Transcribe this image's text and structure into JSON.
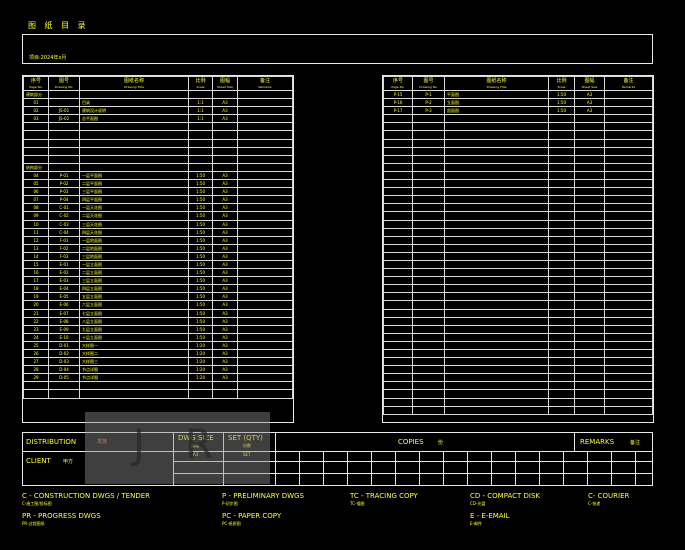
{
  "page_title": "图 纸 目 录",
  "project_line": "项目:2024年x月",
  "col_headers": [
    {
      "zh": "序号",
      "en": "Page No."
    },
    {
      "zh": "图号",
      "en": "Drawing No."
    },
    {
      "zh": "图纸名称",
      "en": "Drawing Title"
    },
    {
      "zh": "比例",
      "en": "Scale"
    },
    {
      "zh": "图幅",
      "en": "Sheet Size"
    },
    {
      "zh": "备注",
      "en": "Remarks"
    }
  ],
  "left_rows": [
    [
      "建筑部分",
      "",
      "",
      "",
      "",
      ""
    ],
    [
      "01",
      "",
      "目录",
      "1:1",
      "A3",
      ""
    ],
    [
      "02",
      "JS-01",
      "建筑设计说明",
      "1:1",
      "A3",
      ""
    ],
    [
      "03",
      "JS-02",
      "总平面图",
      "1:1",
      "A3",
      ""
    ],
    [
      "",
      "",
      "",
      "",
      "",
      ""
    ],
    [
      "",
      "",
      "",
      "",
      "",
      ""
    ],
    [
      "",
      "",
      "",
      "",
      "",
      ""
    ],
    [
      "",
      "",
      "",
      "",
      "",
      ""
    ],
    [
      "",
      "",
      "",
      "",
      "",
      ""
    ],
    [
      "结构部分",
      "",
      "",
      "",
      "",
      ""
    ],
    [
      "04",
      "P-01",
      "一层平面图",
      "1:50",
      "A3",
      ""
    ],
    [
      "05",
      "P-02",
      "二层平面图",
      "1:50",
      "A3",
      ""
    ],
    [
      "06",
      "P-03",
      "三层平面图",
      "1:50",
      "A3",
      ""
    ],
    [
      "07",
      "P-04",
      "四层平面图",
      "1:50",
      "A3",
      ""
    ],
    [
      "08",
      "C-01",
      "一层天花图",
      "1:50",
      "A3",
      ""
    ],
    [
      "09",
      "C-02",
      "二层天花图",
      "1:50",
      "A3",
      ""
    ],
    [
      "10",
      "C-03",
      "三层天花图",
      "1:50",
      "A3",
      ""
    ],
    [
      "11",
      "C-04",
      "四层天花图",
      "1:50",
      "A3",
      ""
    ],
    [
      "12",
      "F-01",
      "一层地面图",
      "1:50",
      "A3",
      ""
    ],
    [
      "13",
      "F-02",
      "二层地面图",
      "1:50",
      "A3",
      ""
    ],
    [
      "14",
      "F-03",
      "三层地面图",
      "1:50",
      "A3",
      ""
    ],
    [
      "15",
      "E-01",
      "一层立面图",
      "1:50",
      "A3",
      ""
    ],
    [
      "16",
      "E-02",
      "二层立面图",
      "1:50",
      "A3",
      ""
    ],
    [
      "17",
      "E-03",
      "三层立面图",
      "1:50",
      "A3",
      ""
    ],
    [
      "18",
      "E-04",
      "四层立面图",
      "1:50",
      "A3",
      ""
    ],
    [
      "19",
      "E-05",
      "五层立面图",
      "1:50",
      "A3",
      ""
    ],
    [
      "20",
      "E-06",
      "六层立面图",
      "1:50",
      "A3",
      ""
    ],
    [
      "21",
      "E-07",
      "七层立面图",
      "1:50",
      "A3",
      ""
    ],
    [
      "22",
      "E-08",
      "八层立面图",
      "1:50",
      "A3",
      ""
    ],
    [
      "23",
      "E-09",
      "九层立面图",
      "1:50",
      "A3",
      ""
    ],
    [
      "24",
      "E-10",
      "十层立面图",
      "1:50",
      "A3",
      ""
    ],
    [
      "25",
      "D-01",
      "大样图一",
      "1:20",
      "A3",
      ""
    ],
    [
      "26",
      "D-02",
      "大样图二",
      "1:20",
      "A3",
      ""
    ],
    [
      "27",
      "D-03",
      "大样图三",
      "1:20",
      "A3",
      ""
    ],
    [
      "28",
      "D-04",
      "节点详图",
      "1:20",
      "A3",
      ""
    ],
    [
      "29",
      "D-05",
      "节点详图",
      "1:20",
      "A3",
      ""
    ],
    [
      "",
      "",
      "",
      "",
      "",
      ""
    ],
    [
      "",
      "",
      "",
      "",
      "",
      ""
    ]
  ],
  "right_rows": [
    [
      "P-15",
      "P-1",
      "平面图",
      "1:50",
      "A3",
      ""
    ],
    [
      "P-16",
      "P-2",
      "立面图",
      "1:50",
      "A3",
      ""
    ],
    [
      "P-17",
      "P-3",
      "剖面图",
      "1:50",
      "A3",
      ""
    ]
  ],
  "right_blank_rows": 37,
  "distribution": {
    "distribution_label": "DISTRIBUTION",
    "distribution_value": "发放",
    "client_label": "CLIENT",
    "client_value": "甲方",
    "dwg_size_label": "DWG SIZE",
    "dwg_size_sub": "图幅",
    "dwg_size_value": "A3",
    "set_label": "SET (QTY)",
    "set_sub": "份数",
    "set_value": "SET",
    "copies_label": "COPIES",
    "copies_value": "份",
    "remarks_label": "REMARKS",
    "remarks_value": "备注"
  },
  "legend": [
    {
      "code": "C - CONSTRUCTION DWGS / TENDER",
      "sub": "C-施工图/投标图"
    },
    {
      "code": "P - PRELIMINARY   DWGS",
      "sub": "P-初步图"
    },
    {
      "code": "TC - TRACING  COPY",
      "sub": "TC-描图"
    },
    {
      "code": "CD - COMPACT DISK",
      "sub": "CD-光盘"
    },
    {
      "code": "C- COURIER",
      "sub": "C-快递"
    },
    {
      "code": "PR - PROGRESS DWGS",
      "sub": "PR-过程图纸"
    },
    {
      "code": "PC - PAPER COPY",
      "sub": "PC-纸质图"
    },
    {
      "code": "E - E-EMAIL",
      "sub": "E-邮件"
    }
  ]
}
